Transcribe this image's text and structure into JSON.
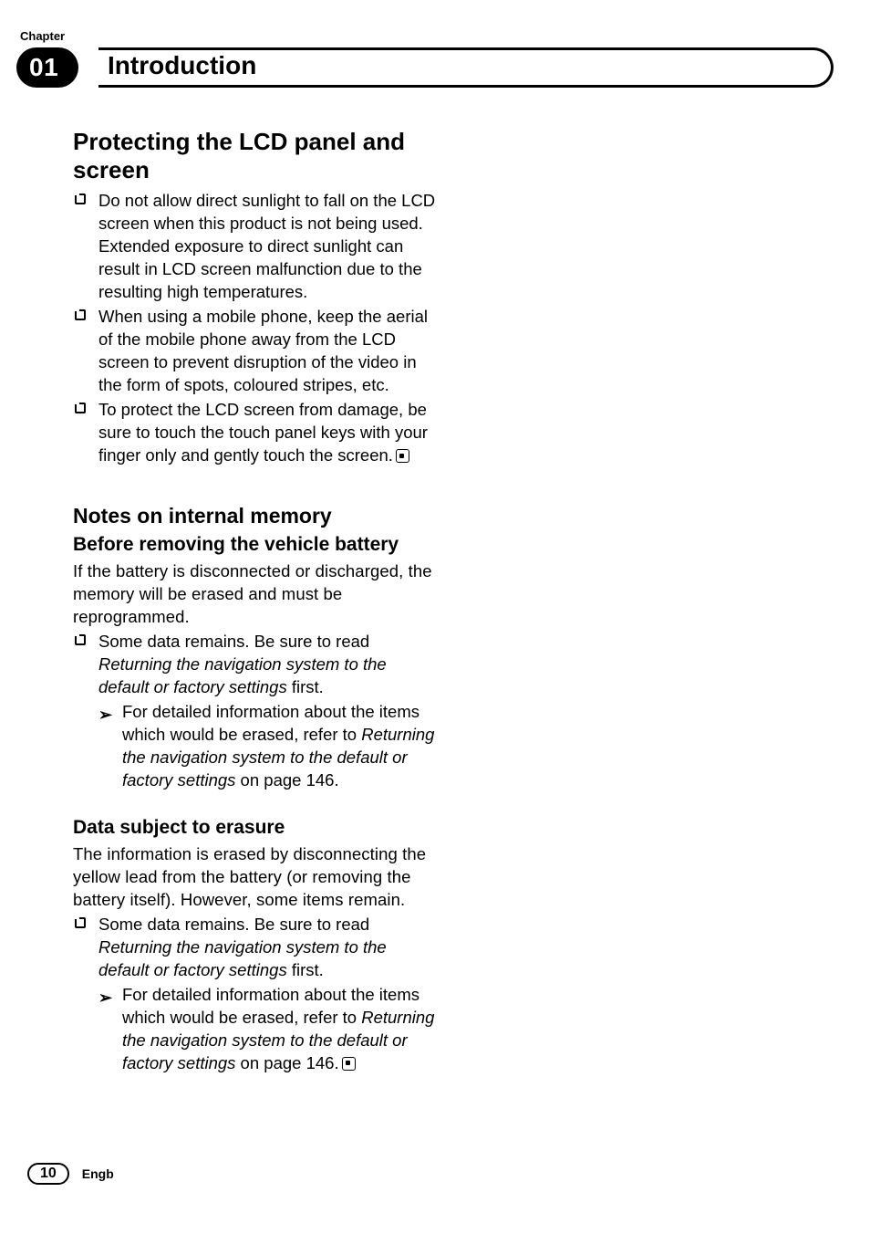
{
  "header": {
    "chapter_label": "Chapter",
    "chapter_number": "01",
    "section_title": "Introduction"
  },
  "sections": {
    "protect": {
      "title": "Protecting the LCD panel and screen",
      "bullets": [
        "Do not allow direct sunlight to fall on the LCD screen when this product is not being used. Extended exposure to direct sunlight can result in LCD screen malfunction due to the resulting high temperatures.",
        "When using a mobile phone, keep the aerial of the mobile phone away from the LCD screen to prevent disruption of the video in the form of spots, coloured stripes, etc.",
        "To protect the LCD screen from damage, be sure to touch the touch panel keys with your finger only and gently touch the screen."
      ]
    },
    "notes": {
      "title": "Notes on internal memory",
      "before": {
        "title": "Before removing the vehicle battery",
        "intro": "If the battery is disconnected or discharged, the memory will be erased and must be reprogrammed.",
        "bullet_pre": "Some data remains. Be sure to read ",
        "bullet_em": "Returning the navigation system to the default or factory settings",
        "bullet_post": " first.",
        "sub_pre": "For detailed information about the items which would be erased, refer to ",
        "sub_em": "Returning the navigation system to the default or factory settings",
        "sub_post": " on page 146."
      },
      "erasure": {
        "title": "Data subject to erasure",
        "intro": "The information is erased by disconnecting the yellow lead from the battery (or removing the battery itself). However, some items remain.",
        "bullet_pre": "Some data remains. Be sure to read ",
        "bullet_em": "Returning the navigation system to the default or factory settings",
        "bullet_post": " first.",
        "sub_pre": "For detailed information about the items which would be erased, refer to ",
        "sub_em": "Returning the navigation system to the default or factory settings",
        "sub_post": " on page 146."
      }
    }
  },
  "footer": {
    "page_number": "10",
    "lang": "Engb"
  },
  "glyphs": {
    "arrow": "➢"
  }
}
